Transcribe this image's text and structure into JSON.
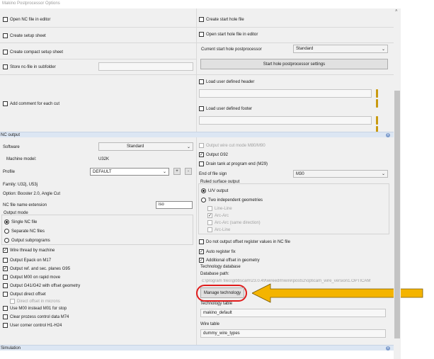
{
  "window": {
    "title": "Makino Postprocessor Options"
  },
  "top": {
    "open_nc": "Open NC file in editor",
    "create_setup": "Create setup sheet",
    "create_compact": "Create compact setup sheet",
    "store_subfolder": "Store nc-file in subfolder",
    "comment_each_cut": "Add comment for each cut",
    "create_start_hole": "Create start hole file",
    "open_start_hole": "Open start hole file in editor",
    "current_start_pp_label": "Current start hole postprocessor",
    "current_start_pp_value": "Standard",
    "start_pp_settings": "Start hole postprocessor settings",
    "load_header": "Load user defined header",
    "load_footer": "Load user defined footer"
  },
  "nc_output": {
    "header": "NC output",
    "software_label": "Software",
    "software_value": "Standard",
    "machine_model_label": "Machine model:",
    "machine_model_value": "U32K",
    "profile_label": "Profile",
    "profile_value": "DEFAULT",
    "plus": "+",
    "minus": "-",
    "family": "Family:  U32j, U53j",
    "option": "Option:  Booster 2.0, Angle Cut",
    "ext_label": "NC file name extension",
    "ext_value": "iso",
    "output_mode": "Output mode",
    "single_nc": "Single NC file",
    "separate_nc": "Separate NC files",
    "output_sub": "Output subprograms",
    "wire_thread": "Wire thread by machine",
    "output_epack": "Output Epack on M17",
    "output_ref": "Output ref. and sec. planes G95",
    "output_m00": "Output M00 on rapid move",
    "output_g41": "Output G41/G42 with offset geometry",
    "output_direct": "Output direct offset",
    "direct_microns": "Direct offset in microns",
    "use_m00": "Use M00 instead M01 for stop",
    "clear_process": "Clear prozess control data M74",
    "user_corner": "User corner control H1-H24",
    "wire_cut_mode": "Output wire cut mode M80/M90",
    "output_g92": "Output G92",
    "drain_tank": "Drain tank at program end (M29)",
    "end_of_file_label": "End of file sign",
    "end_of_file_value": "M30",
    "ruled_surface": "Ruled surface output",
    "uv_output": "U/V output",
    "two_geom": "Two independent geometries",
    "line_line": "Line-Line",
    "arc_arc": "Arc-Arc",
    "arc_arc_same": "Arc-Arc (same direction)",
    "arc_line": "Arc-Line",
    "no_offset_reg": "Do not output offset register values in NC file",
    "auto_register": "Auto register fix",
    "additional_offset": "Additional offset in geometry",
    "tech_db": "Technology database",
    "db_path_label": "Database path:",
    "db_path_value": "c:\\program files\\gibbscam\\23.0.49\\wireedm\\wire\\posts2\\opticam_wire_version1.OPTICAM",
    "manage_tech": "Manage technology",
    "tech_table_label": "Technology table",
    "tech_table_value": "makino_default",
    "wire_table_label": "Wire table",
    "wire_table_value": "dummy_wire_types"
  },
  "simulation": {
    "header": "Simulation"
  },
  "icons": {
    "collapse": "collapse-icon",
    "folder": "folder-icon",
    "arrow": "callout-arrow"
  },
  "colors": {
    "highlight_ring": "#e01b1b",
    "arrow_fill": "#f4b400",
    "section_header": "#dce6f3"
  }
}
